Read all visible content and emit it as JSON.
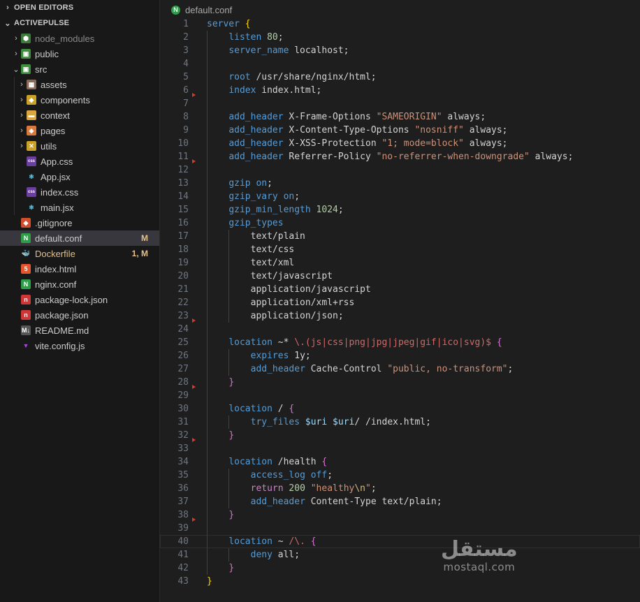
{
  "sidebar": {
    "open_editors": "OPEN EDITORS",
    "project": "ACTIVEPULSE",
    "tree": [
      {
        "label": "node_modules",
        "depth": 1,
        "twisty": "›",
        "icon": "node-modules-folder-icon",
        "icon_bg": "#3c7b3c",
        "icon_glyph": "⬢",
        "dim": true
      },
      {
        "label": "public",
        "depth": 1,
        "twisty": "›",
        "icon": "public-folder-icon",
        "icon_bg": "#3d8f3d",
        "icon_glyph": "▣"
      },
      {
        "label": "src",
        "depth": 1,
        "twisty": "⌄",
        "icon": "src-folder-icon",
        "icon_bg": "#3d8f3d",
        "icon_glyph": "▣"
      },
      {
        "label": "assets",
        "depth": 2,
        "twisty": "›",
        "icon": "assets-folder-icon",
        "icon_bg": "#8a6b5a",
        "icon_glyph": "▦"
      },
      {
        "label": "components",
        "depth": 2,
        "twisty": "›",
        "icon": "components-folder-icon",
        "icon_bg": "#c9a227",
        "icon_glyph": "◆"
      },
      {
        "label": "context",
        "depth": 2,
        "twisty": "›",
        "icon": "context-folder-icon",
        "icon_bg": "#d9a640",
        "icon_glyph": "▬"
      },
      {
        "label": "pages",
        "depth": 2,
        "twisty": "›",
        "icon": "pages-folder-icon",
        "icon_bg": "#d97a3c",
        "icon_glyph": "◈"
      },
      {
        "label": "utils",
        "depth": 2,
        "twisty": "›",
        "icon": "utils-folder-icon",
        "icon_bg": "#c9a227",
        "icon_glyph": "✕"
      },
      {
        "label": "App.css",
        "depth": 2,
        "twisty": "",
        "icon": "css-file-icon",
        "icon_bg": "#6b3fa0",
        "icon_glyph": "css"
      },
      {
        "label": "App.jsx",
        "depth": 2,
        "twisty": "",
        "icon": "react-file-icon",
        "icon_bg": "transparent",
        "icon_glyph": "⚛"
      },
      {
        "label": "index.css",
        "depth": 2,
        "twisty": "",
        "icon": "css-file-icon",
        "icon_bg": "#6b3fa0",
        "icon_glyph": "css"
      },
      {
        "label": "main.jsx",
        "depth": 2,
        "twisty": "",
        "icon": "react-file-icon",
        "icon_bg": "transparent",
        "icon_glyph": "⚛"
      },
      {
        "label": ".gitignore",
        "depth": 1,
        "twisty": "",
        "icon": "git-file-icon",
        "icon_bg": "#d24d2c",
        "icon_glyph": "◆"
      },
      {
        "label": "default.conf",
        "depth": 1,
        "twisty": "",
        "icon": "nginx-file-icon",
        "icon_bg": "#2e9e48",
        "icon_glyph": "N",
        "selected": true,
        "badge": "M"
      },
      {
        "label": "Dockerfile",
        "depth": 1,
        "twisty": "",
        "icon": "docker-file-icon",
        "icon_bg": "transparent",
        "icon_glyph": "🐳",
        "modified": true,
        "badge": "1, M"
      },
      {
        "label": "index.html",
        "depth": 1,
        "twisty": "",
        "icon": "html-file-icon",
        "icon_bg": "#e4572e",
        "icon_glyph": "5"
      },
      {
        "label": "nginx.conf",
        "depth": 1,
        "twisty": "",
        "icon": "nginx-file-icon",
        "icon_bg": "#2e9e48",
        "icon_glyph": "N"
      },
      {
        "label": "package-lock.json",
        "depth": 1,
        "twisty": "",
        "icon": "npm-file-icon",
        "icon_bg": "#cb3837",
        "icon_glyph": "n"
      },
      {
        "label": "package.json",
        "depth": 1,
        "twisty": "",
        "icon": "npm-file-icon",
        "icon_bg": "#cb3837",
        "icon_glyph": "n"
      },
      {
        "label": "README.md",
        "depth": 1,
        "twisty": "",
        "icon": "markdown-file-icon",
        "icon_bg": "#555555",
        "icon_glyph": "M↓"
      },
      {
        "label": "vite.config.js",
        "depth": 1,
        "twisty": "",
        "icon": "vite-file-icon",
        "icon_bg": "transparent",
        "icon_glyph": "▼"
      }
    ]
  },
  "editor": {
    "breadcrumb": "default.conf",
    "breadcrumb_icon_glyph": "N",
    "current_line": 40,
    "code": [
      {
        "n": "1",
        "t": [
          [
            "t-kw",
            "server"
          ],
          [
            "t-txt",
            " "
          ],
          [
            "t-brace",
            "{"
          ]
        ]
      },
      {
        "n": "2",
        "t": [
          [
            "t-txt",
            "    "
          ],
          [
            "t-dir2",
            "listen"
          ],
          [
            "t-txt",
            " "
          ],
          [
            "t-num",
            "80"
          ],
          [
            "t-txt",
            ";"
          ]
        ]
      },
      {
        "n": "3",
        "t": [
          [
            "t-txt",
            "    "
          ],
          [
            "t-dir2",
            "server_name"
          ],
          [
            "t-txt",
            " localhost;"
          ]
        ]
      },
      {
        "n": "4",
        "t": []
      },
      {
        "n": "5",
        "t": [
          [
            "t-txt",
            "    "
          ],
          [
            "t-dir2",
            "root"
          ],
          [
            "t-txt",
            " /usr/share/nginx/html;"
          ]
        ]
      },
      {
        "n": "6",
        "t": [
          [
            "t-txt",
            "    "
          ],
          [
            "t-dir2",
            "index"
          ],
          [
            "t-txt",
            " index.html;"
          ]
        ]
      },
      {
        "n": "7",
        "t": [],
        "marker": true
      },
      {
        "n": "8",
        "t": [
          [
            "t-txt",
            "    "
          ],
          [
            "t-dir2",
            "add_header"
          ],
          [
            "t-txt",
            " X-Frame-Options "
          ],
          [
            "t-str",
            "\"SAMEORIGIN\""
          ],
          [
            "t-txt",
            " always;"
          ]
        ]
      },
      {
        "n": "9",
        "t": [
          [
            "t-txt",
            "    "
          ],
          [
            "t-dir2",
            "add_header"
          ],
          [
            "t-txt",
            " X-Content-Type-Options "
          ],
          [
            "t-str",
            "\"nosniff\""
          ],
          [
            "t-txt",
            " always;"
          ]
        ]
      },
      {
        "n": "10",
        "t": [
          [
            "t-txt",
            "    "
          ],
          [
            "t-dir2",
            "add_header"
          ],
          [
            "t-txt",
            " X-XSS-Protection "
          ],
          [
            "t-str",
            "\"1; mode=block\""
          ],
          [
            "t-txt",
            " always;"
          ]
        ]
      },
      {
        "n": "11",
        "t": [
          [
            "t-txt",
            "    "
          ],
          [
            "t-dir2",
            "add_header"
          ],
          [
            "t-txt",
            " Referrer-Policy "
          ],
          [
            "t-str",
            "\"no-referrer-when-downgrade\""
          ],
          [
            "t-txt",
            " always;"
          ]
        ]
      },
      {
        "n": "12",
        "t": [],
        "marker": true
      },
      {
        "n": "13",
        "t": [
          [
            "t-txt",
            "    "
          ],
          [
            "t-dir2",
            "gzip"
          ],
          [
            "t-txt",
            " "
          ],
          [
            "t-kw",
            "on"
          ],
          [
            "t-txt",
            ";"
          ]
        ]
      },
      {
        "n": "14",
        "t": [
          [
            "t-txt",
            "    "
          ],
          [
            "t-dir2",
            "gzip_vary"
          ],
          [
            "t-txt",
            " "
          ],
          [
            "t-kw",
            "on"
          ],
          [
            "t-txt",
            ";"
          ]
        ]
      },
      {
        "n": "15",
        "t": [
          [
            "t-txt",
            "    "
          ],
          [
            "t-dir2",
            "gzip_min_length"
          ],
          [
            "t-txt",
            " "
          ],
          [
            "t-num",
            "1024"
          ],
          [
            "t-txt",
            ";"
          ]
        ]
      },
      {
        "n": "16",
        "t": [
          [
            "t-txt",
            "    "
          ],
          [
            "t-dir2",
            "gzip_types"
          ]
        ]
      },
      {
        "n": "17",
        "t": [
          [
            "t-txt",
            "        text/plain"
          ]
        ]
      },
      {
        "n": "18",
        "t": [
          [
            "t-txt",
            "        text/css"
          ]
        ]
      },
      {
        "n": "19",
        "t": [
          [
            "t-txt",
            "        text/xml"
          ]
        ]
      },
      {
        "n": "20",
        "t": [
          [
            "t-txt",
            "        text/javascript"
          ]
        ]
      },
      {
        "n": "21",
        "t": [
          [
            "t-txt",
            "        application/javascript"
          ]
        ]
      },
      {
        "n": "22",
        "t": [
          [
            "t-txt",
            "        application/xml+rss"
          ]
        ]
      },
      {
        "n": "23",
        "t": [
          [
            "t-txt",
            "        application/json;"
          ]
        ]
      },
      {
        "n": "24",
        "t": [],
        "marker": true
      },
      {
        "n": "25",
        "t": [
          [
            "t-txt",
            "    "
          ],
          [
            "t-dir2",
            "location"
          ],
          [
            "t-txt",
            " ~* "
          ],
          [
            "t-re",
            "\\.(js|css|png|jpg|jpeg|gif|ico|svg)$"
          ],
          [
            "t-txt",
            " "
          ],
          [
            "t-brace2",
            "{"
          ]
        ]
      },
      {
        "n": "26",
        "t": [
          [
            "t-txt",
            "        "
          ],
          [
            "t-dir2",
            "expires"
          ],
          [
            "t-txt",
            " 1y;"
          ]
        ]
      },
      {
        "n": "27",
        "t": [
          [
            "t-txt",
            "        "
          ],
          [
            "t-dir2",
            "add_header"
          ],
          [
            "t-txt",
            " Cache-Control "
          ],
          [
            "t-str",
            "\"public, no-transform\""
          ],
          [
            "t-txt",
            ";"
          ]
        ]
      },
      {
        "n": "28",
        "t": [
          [
            "t-txt",
            "    "
          ],
          [
            "t-brace2",
            "}"
          ]
        ]
      },
      {
        "n": "29",
        "t": [],
        "marker": true
      },
      {
        "n": "30",
        "t": [
          [
            "t-txt",
            "    "
          ],
          [
            "t-dir2",
            "location"
          ],
          [
            "t-txt",
            " / "
          ],
          [
            "t-brace2",
            "{"
          ]
        ]
      },
      {
        "n": "31",
        "t": [
          [
            "t-txt",
            "        "
          ],
          [
            "t-dir2",
            "try_files"
          ],
          [
            "t-txt",
            " "
          ],
          [
            "t-var",
            "$uri"
          ],
          [
            "t-txt",
            " "
          ],
          [
            "t-var",
            "$uri"
          ],
          [
            "t-txt",
            "/ /index.html;"
          ]
        ]
      },
      {
        "n": "32",
        "t": [
          [
            "t-txt",
            "    "
          ],
          [
            "t-brace2",
            "}"
          ]
        ]
      },
      {
        "n": "33",
        "t": [],
        "marker": true
      },
      {
        "n": "34",
        "t": [
          [
            "t-txt",
            "    "
          ],
          [
            "t-dir2",
            "location"
          ],
          [
            "t-txt",
            " /health "
          ],
          [
            "t-brace2",
            "{"
          ]
        ]
      },
      {
        "n": "35",
        "t": [
          [
            "t-txt",
            "        "
          ],
          [
            "t-dir2",
            "access_log"
          ],
          [
            "t-txt",
            " "
          ],
          [
            "t-kw",
            "off"
          ],
          [
            "t-txt",
            ";"
          ]
        ]
      },
      {
        "n": "36",
        "t": [
          [
            "t-txt",
            "        "
          ],
          [
            "t-ret",
            "return"
          ],
          [
            "t-txt",
            " "
          ],
          [
            "t-num",
            "200"
          ],
          [
            "t-txt",
            " "
          ],
          [
            "t-str",
            "\"healthy"
          ],
          [
            "t-esc",
            "\\n"
          ],
          [
            "t-str",
            "\""
          ],
          [
            "t-txt",
            ";"
          ]
        ]
      },
      {
        "n": "37",
        "t": [
          [
            "t-txt",
            "        "
          ],
          [
            "t-dir2",
            "add_header"
          ],
          [
            "t-txt",
            " Content-Type text/plain;"
          ]
        ]
      },
      {
        "n": "38",
        "t": [
          [
            "t-txt",
            "    "
          ],
          [
            "t-brace2",
            "}"
          ]
        ]
      },
      {
        "n": "39",
        "t": [],
        "marker": true
      },
      {
        "n": "40",
        "t": [
          [
            "t-txt",
            "    "
          ],
          [
            "t-dir2",
            "location"
          ],
          [
            "t-txt",
            " ~ "
          ],
          [
            "t-re",
            "/\\."
          ],
          [
            "t-txt",
            " "
          ],
          [
            "t-brace2",
            "{"
          ]
        ]
      },
      {
        "n": "41",
        "t": [
          [
            "t-txt",
            "        "
          ],
          [
            "t-dir2",
            "deny"
          ],
          [
            "t-txt",
            " all;"
          ]
        ]
      },
      {
        "n": "42",
        "t": [
          [
            "t-txt",
            "    "
          ],
          [
            "t-brace2",
            "}"
          ]
        ]
      },
      {
        "n": "43",
        "t": [
          [
            "t-brace",
            "}"
          ]
        ]
      }
    ]
  },
  "watermark": {
    "arabic": "مستقل",
    "latin": "mostaql.com"
  }
}
